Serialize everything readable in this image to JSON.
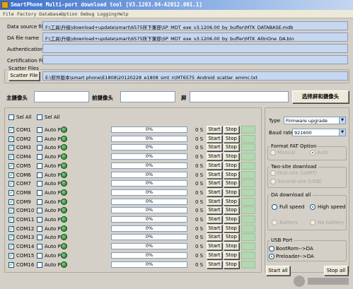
{
  "window": {
    "title": "SmartPhone Multi-port download tool [V3.1203.04-A2012.001.1]"
  },
  "menu": [
    "File",
    "Factory Database",
    "Option",
    "Debug Logging",
    "Help"
  ],
  "files": [
    {
      "label": "Data source file",
      "value": "F:\\工具\\升级\\download+update\\smart\\6575所下兼容\\SP_MDT_exe_v3.1206.00_by_buffer\\MTK_DATABASE.mdb"
    },
    {
      "label": "DA file name",
      "value": "F:\\工具\\升级\\download+update\\smart\\6575所下兼容\\SP_MDT_exe_v3.1206.00_by_buffer\\MTK_AllInOne_DA.bin"
    },
    {
      "label": "Authentication file",
      "value": ""
    },
    {
      "label": "Certification File",
      "value": ""
    }
  ],
  "scatter": {
    "group_label": "Scatter Files",
    "button": "Scatter File",
    "value": "E:\\软件版本\\smart phone\\E1808\\20120228_e1808_smt_n\\MT6575_Android_scatter_emmc.txt"
  },
  "camera": {
    "main_label": "主摄像头",
    "front_label": "前摄像头",
    "screen_label": "屏",
    "select_button": "选择屏和摄像头"
  },
  "select_all": {
    "sel_all": "Sel All",
    "sel_all_auto": "Sel All"
  },
  "coms": [
    {
      "name": "COM1",
      "progress": "0%",
      "time": "0 S",
      "auto": "Auto PL"
    },
    {
      "name": "COM2",
      "progress": "0%",
      "time": "0 S",
      "auto": "Auto PL"
    },
    {
      "name": "COM3",
      "progress": "0%",
      "time": "0 S",
      "auto": "Auto PL"
    },
    {
      "name": "COM4",
      "progress": "0%",
      "time": "0 S",
      "auto": "Auto PL"
    },
    {
      "name": "COM5",
      "progress": "0%",
      "time": "0 S",
      "auto": "Auto PL"
    },
    {
      "name": "COM6",
      "progress": "0%",
      "time": "0 S",
      "auto": "Auto PL"
    },
    {
      "name": "COM7",
      "progress": "0%",
      "time": "0 S",
      "auto": "Auto PL"
    },
    {
      "name": "COM8",
      "progress": "0%",
      "time": "0 S",
      "auto": "Auto PL"
    },
    {
      "name": "COM9",
      "progress": "0%",
      "time": "0 S",
      "auto": "Auto PL"
    },
    {
      "name": "COM10",
      "progress": "0%",
      "time": "0 S",
      "auto": "Auto PL"
    },
    {
      "name": "COM11",
      "progress": "0%",
      "time": "0 S",
      "auto": "Auto PL"
    },
    {
      "name": "COM12",
      "progress": "0%",
      "time": "0 S",
      "auto": "Auto PL"
    },
    {
      "name": "COM13",
      "progress": "0%",
      "time": "0 S",
      "auto": "Auto PL"
    },
    {
      "name": "COM14",
      "progress": "0%",
      "time": "0 S",
      "auto": "Auto PL"
    },
    {
      "name": "COM15",
      "progress": "0%",
      "time": "0 S",
      "auto": "Auto PL"
    },
    {
      "name": "COM16",
      "progress": "0%",
      "time": "0 S",
      "auto": "Auto PL"
    }
  ],
  "row_buttons": {
    "start": "Start",
    "stop": "Stop"
  },
  "type": {
    "label": "Type",
    "value": "Firmware upgrade"
  },
  "baud": {
    "label": "Baud rate",
    "value": "921600"
  },
  "format_fat": {
    "title": "Format FAT Option",
    "manual": "Manual",
    "auto": "Auto"
  },
  "two_site": {
    "title": "Two-site download",
    "first": "First-site (UART)",
    "second": "Second-site (USB)"
  },
  "da_download": {
    "title": "DA download all",
    "full": "Full speed",
    "high": "High speed",
    "battery": "Battery",
    "no_battery": "No battery"
  },
  "usb_port": {
    "title": "USB Port",
    "bootrom": "BootRom-->DA",
    "preloader": "Preloader-->DA"
  },
  "actions": {
    "start_all": "Start all",
    "stop_all": "Stop all"
  },
  "colors": {
    "led": "#1e6e1e",
    "field_bg": "#c6d7ef",
    "titlebar": "#3a6fc9"
  }
}
